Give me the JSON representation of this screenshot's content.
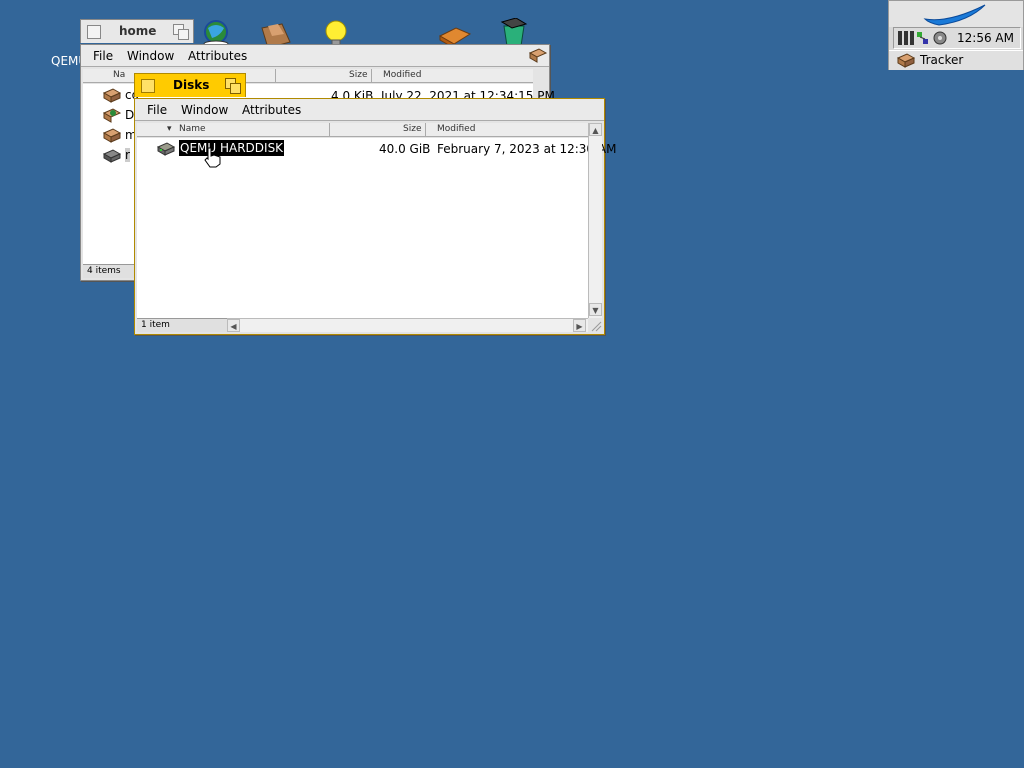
{
  "desktop": {
    "partial_label": "QEMU"
  },
  "deskbar": {
    "clock": "12:56 AM",
    "tracker_label": "Tracker"
  },
  "home_window": {
    "title": "home",
    "menu": {
      "file": "File",
      "window": "Window",
      "attributes": "Attributes"
    },
    "columns": {
      "name": "Na",
      "size": "Size",
      "modified": "Modified"
    },
    "rows": [
      {
        "name": "co",
        "size": "4.0 KiB",
        "modified": "July 22, 2021 at 12:34:15 PM"
      },
      {
        "name": "D",
        "size": "",
        "modified": ""
      },
      {
        "name": "m",
        "size": "",
        "modified": ""
      },
      {
        "name": "r",
        "size": "",
        "modified": ""
      }
    ],
    "status": "4 items"
  },
  "disks_window": {
    "title": "Disks",
    "menu": {
      "file": "File",
      "window": "Window",
      "attributes": "Attributes"
    },
    "columns": {
      "name": "Name",
      "size": "Size",
      "modified": "Modified"
    },
    "rows": [
      {
        "name": "QEMU HARDDISK",
        "size": "40.0 GiB",
        "modified": "February 7, 2023 at 12:30 AM"
      }
    ],
    "status": "1 item"
  },
  "colors": {
    "desktop": "#336699",
    "active_tab": "#ffcb00"
  }
}
